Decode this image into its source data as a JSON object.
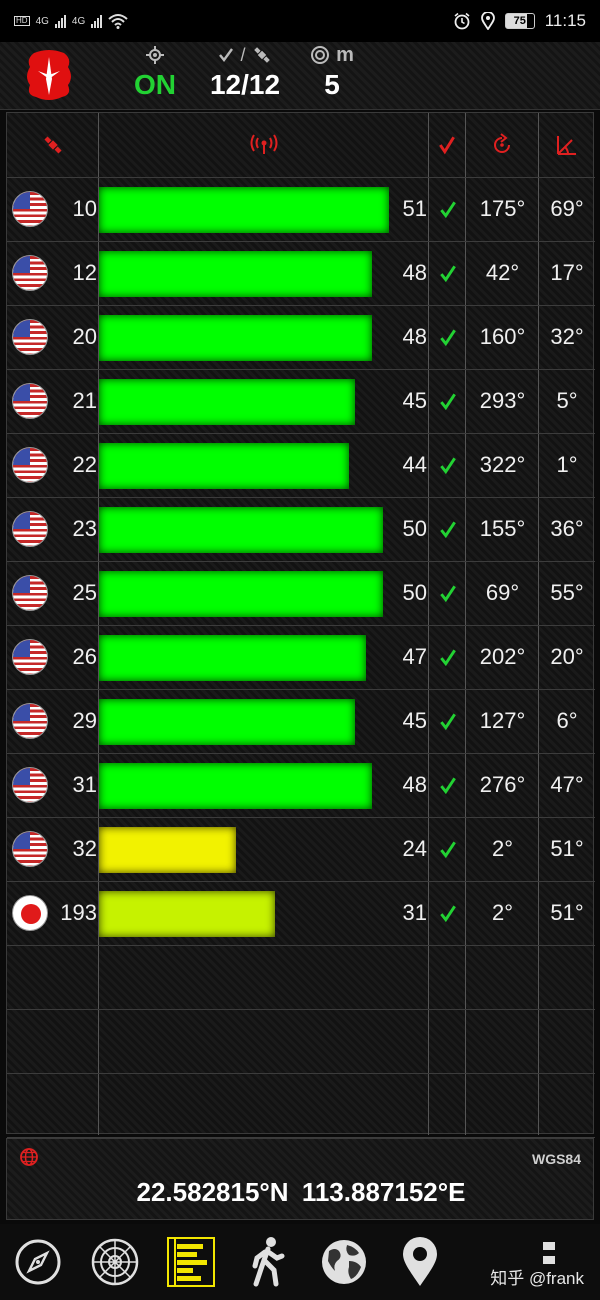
{
  "status_bar": {
    "network_1": "4G",
    "network_2": "4G",
    "battery": "75",
    "time": "11:15"
  },
  "header": {
    "gps_status": "ON",
    "sats_used_total": "12/12",
    "accuracy": "5",
    "accuracy_unit": "m"
  },
  "colors": {
    "strong": "#00ff00",
    "medium": "#c6f200",
    "weak": "#f2f200",
    "check": "#22d233",
    "header_icon": "#e02020"
  },
  "satellites": [
    {
      "flag": "us",
      "prn": "10",
      "snr": 51,
      "snr_text": "51",
      "azimuth": "175°",
      "elevation": "69°"
    },
    {
      "flag": "us",
      "prn": "12",
      "snr": 48,
      "snr_text": "48",
      "azimuth": "42°",
      "elevation": "17°"
    },
    {
      "flag": "us",
      "prn": "20",
      "snr": 48,
      "snr_text": "48",
      "azimuth": "160°",
      "elevation": "32°"
    },
    {
      "flag": "us",
      "prn": "21",
      "snr": 45,
      "snr_text": "45",
      "azimuth": "293°",
      "elevation": "5°"
    },
    {
      "flag": "us",
      "prn": "22",
      "snr": 44,
      "snr_text": "44",
      "azimuth": "322°",
      "elevation": "1°"
    },
    {
      "flag": "us",
      "prn": "23",
      "snr": 50,
      "snr_text": "50",
      "azimuth": "155°",
      "elevation": "36°"
    },
    {
      "flag": "us",
      "prn": "25",
      "snr": 50,
      "snr_text": "50",
      "azimuth": "69°",
      "elevation": "55°"
    },
    {
      "flag": "us",
      "prn": "26",
      "snr": 47,
      "snr_text": "47",
      "azimuth": "202°",
      "elevation": "20°"
    },
    {
      "flag": "us",
      "prn": "29",
      "snr": 45,
      "snr_text": "45",
      "azimuth": "127°",
      "elevation": "6°"
    },
    {
      "flag": "us",
      "prn": "31",
      "snr": 48,
      "snr_text": "48",
      "azimuth": "276°",
      "elevation": "47°"
    },
    {
      "flag": "us",
      "prn": "32",
      "snr": 24,
      "snr_text": "24",
      "azimuth": "2°",
      "elevation": "51°"
    },
    {
      "flag": "jp",
      "prn": "193",
      "snr": 31,
      "snr_text": "31",
      "azimuth": "2°",
      "elevation": "51°"
    }
  ],
  "coords": {
    "datum": "WGS84",
    "latitude": "22.582815°N",
    "longitude": "113.887152°E"
  },
  "nav": {
    "items": [
      {
        "icon": "compass-icon"
      },
      {
        "icon": "radar-icon"
      },
      {
        "icon": "signal-bars-icon"
      },
      {
        "icon": "walking-icon"
      },
      {
        "icon": "globe-icon"
      },
      {
        "icon": "map-pin-icon"
      },
      {
        "icon": "more-icon"
      }
    ],
    "watermark": "知乎 @frank"
  }
}
